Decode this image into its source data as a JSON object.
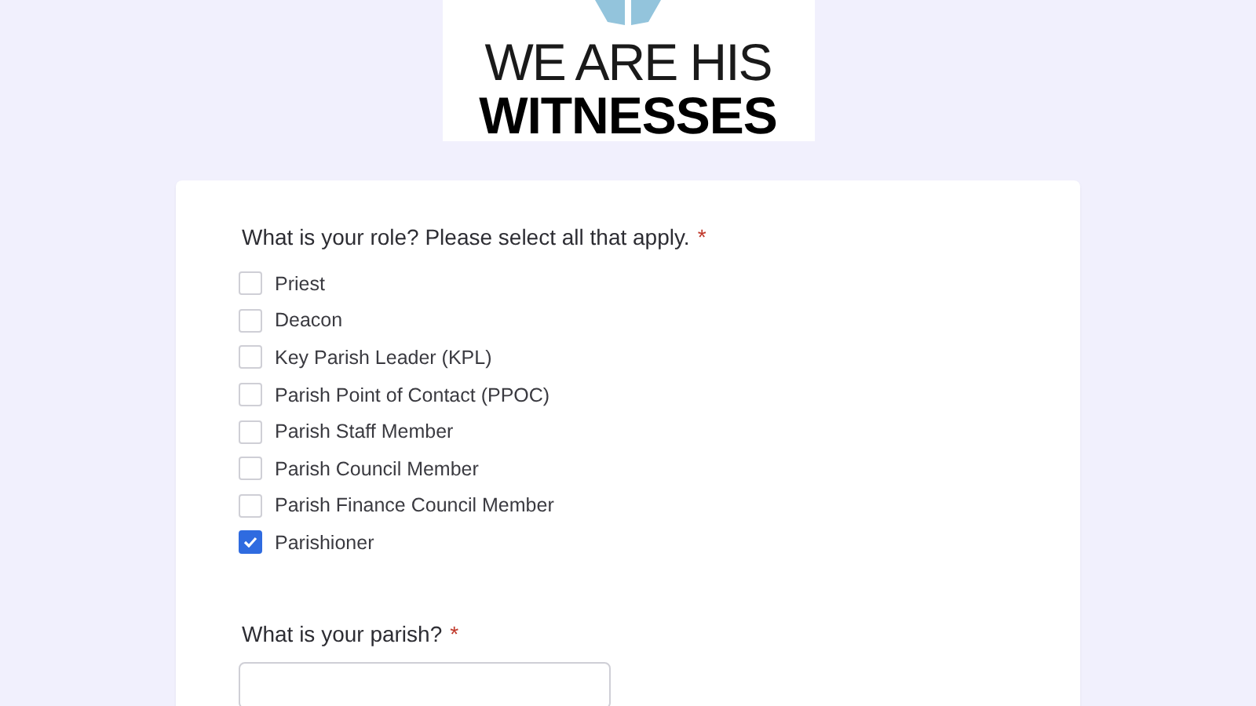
{
  "logo": {
    "line_1": "WE ARE HIS",
    "line_2": "WITNESSES"
  },
  "questions": [
    {
      "kind": "checkboxes",
      "label": "What is your role? Please select all that apply.",
      "required_mark": "*",
      "options": [
        {
          "label": "Priest",
          "checked": false
        },
        {
          "label": "Deacon",
          "checked": false
        },
        {
          "label": "Key Parish Leader (KPL)",
          "checked": false
        },
        {
          "label": "Parish Point of Contact (PPOC)",
          "checked": false
        },
        {
          "label": "Parish Staff Member",
          "checked": false
        },
        {
          "label": "Parish Council Member",
          "checked": false
        },
        {
          "label": "Parish Finance Council Member",
          "checked": false
        },
        {
          "label": "Parishioner",
          "checked": true
        }
      ]
    },
    {
      "kind": "text",
      "label": "What is your parish?",
      "required_mark": "*"
    }
  ]
}
